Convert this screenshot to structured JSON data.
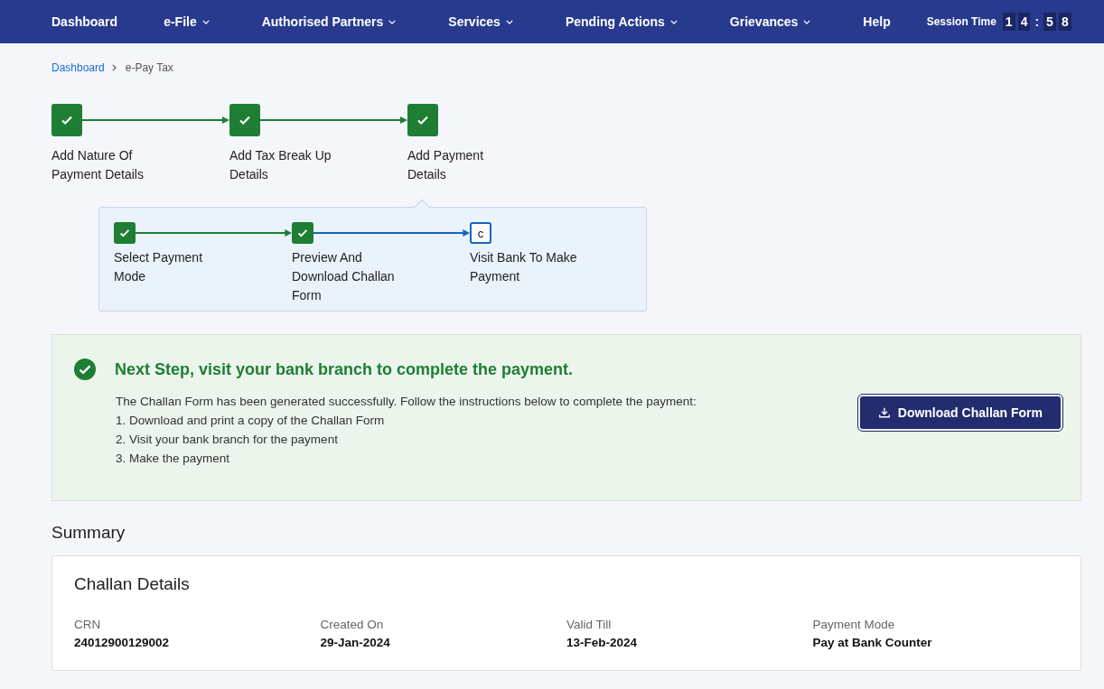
{
  "nav": {
    "items": [
      {
        "label": "Dashboard",
        "dropdown": false
      },
      {
        "label": "e-File",
        "dropdown": true
      },
      {
        "label": "Authorised Partners",
        "dropdown": true
      },
      {
        "label": "Services",
        "dropdown": true
      },
      {
        "label": "Pending Actions",
        "dropdown": true
      },
      {
        "label": "Grievances",
        "dropdown": true
      },
      {
        "label": "Help",
        "dropdown": false
      }
    ],
    "session": {
      "label": "Session Time",
      "hours": [
        "1",
        "4"
      ],
      "separator": ":",
      "minutes": [
        "5",
        "8"
      ]
    }
  },
  "breadcrumb": [
    {
      "label": "Dashboard",
      "link": true
    },
    {
      "label": "e-Pay Tax",
      "link": false
    }
  ],
  "steps": [
    {
      "label": "Add Nature Of Payment Details",
      "completed": true
    },
    {
      "label": "Add Tax Break Up Details",
      "completed": true
    },
    {
      "label": "Add Payment Details",
      "completed": true,
      "expanded": true
    }
  ],
  "substeps": [
    {
      "label": "Select Payment Mode",
      "completed": true
    },
    {
      "label": "Preview And Download Challan Form",
      "completed": true
    },
    {
      "label": "Visit Bank To Make Payment",
      "completed": false,
      "marker": "c"
    }
  ],
  "notice": {
    "title": "Next Step, visit your bank branch to complete the payment.",
    "intro": "The Challan Form has been generated successfully. Follow the instructions below to complete the payment:",
    "instructions": [
      "1. Download and print a copy of the Challan Form",
      "2. Visit your bank branch for the payment",
      "3. Make the payment"
    ],
    "button": "Download Challan Form"
  },
  "summary": {
    "title": "Summary",
    "card_title": "Challan Details",
    "fields": [
      {
        "label": "CRN",
        "value": "24012900129002"
      },
      {
        "label": "Created On",
        "value": "29-Jan-2024"
      },
      {
        "label": "Valid Till",
        "value": "13-Feb-2024"
      },
      {
        "label": "Payment Mode",
        "value": "Pay at Bank Counter"
      }
    ]
  }
}
